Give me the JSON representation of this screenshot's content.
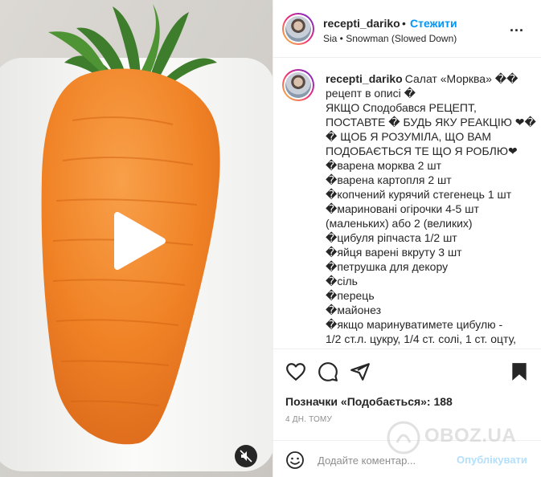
{
  "header": {
    "username": "recepti_dariko",
    "separator": "•",
    "follow_label": "Стежити",
    "music": "Sia • Snowman (Slowed Down)",
    "more_label": "..."
  },
  "caption": {
    "username": "recepti_dariko",
    "lines": [
      "Салат «Морква» ��",
      "рецепт в описі �",
      "ЯКЩО Сподобався РЕЦЕПТ,",
      "ПОСТАВТЕ � БУДЬ ЯКУ РЕАКЦІЮ ❤�",
      "� ЩОБ Я РОЗУМІЛА, ЩО ВАМ",
      "ПОДОБАЄТЬСЯ ТЕ ЩО Я РОБЛЮ❤",
      "�варена морква 2 шт",
      "�варена картопля 2 шт",
      "�копчений курячий стегенець 1 шт",
      "�мариновані огірочки 4-5 шт",
      "(маленьких) або 2 (великих)",
      "�цибуля ріпчаста 1/2 шт",
      "�яйця варені вкруту 3 шт",
      "�петрушка для декору",
      "�сіль",
      "�перець",
      "�майонез",
      "�якщо маринуватимете цибулю -",
      "1/2 ст.л. цукру, 1/4 ст. солі, 1 ст. оцту,"
    ]
  },
  "actions": {
    "like_icon": "heart-icon",
    "comment_icon": "comment-icon",
    "share_icon": "paper-plane-icon",
    "save_icon": "bookmark-icon"
  },
  "likes": {
    "label": "Позначки «Подобається»: 188"
  },
  "timestamp": "4 ДН. ТОМУ",
  "comment": {
    "placeholder": "Додайте коментар...",
    "post_label": "Опублікувати"
  },
  "watermark": {
    "text": "OBOZ.UA"
  },
  "colors": {
    "accent": "#0095f6",
    "post_disabled": "#b2dffc",
    "carrot": "#f07d1e",
    "plate": "#ffffff"
  }
}
